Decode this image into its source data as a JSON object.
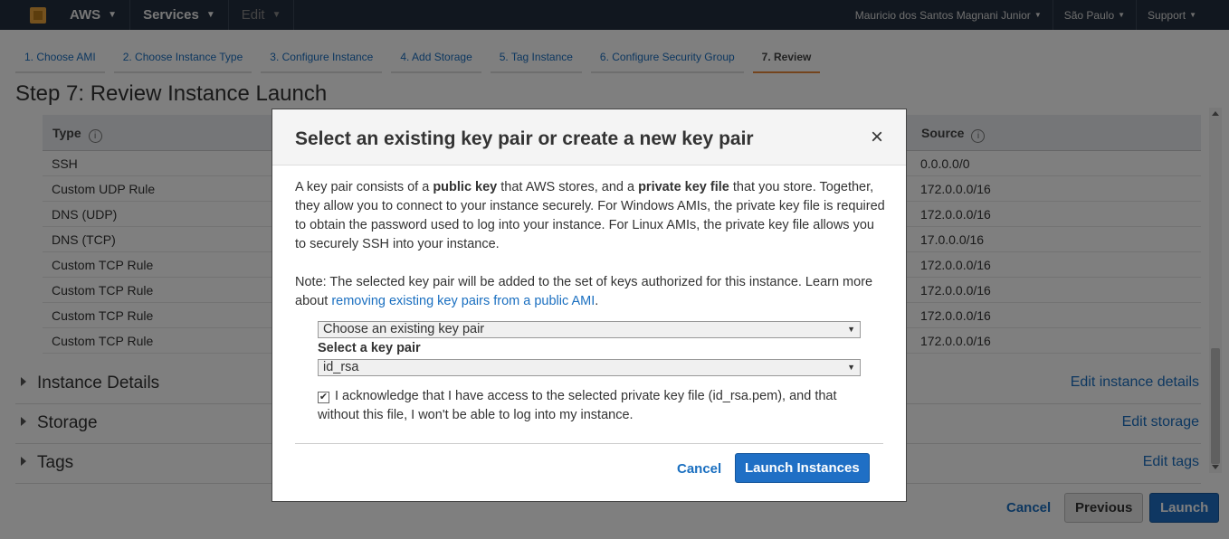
{
  "topnav": {
    "aws_label": "AWS",
    "services_label": "Services",
    "edit_label": "Edit",
    "user_label": "Mauricio dos Santos Magnani Junior",
    "region_label": "São Paulo",
    "support_label": "Support"
  },
  "wizard": {
    "tabs": [
      {
        "label": "1. Choose AMI"
      },
      {
        "label": "2. Choose Instance Type"
      },
      {
        "label": "3. Configure Instance"
      },
      {
        "label": "4. Add Storage"
      },
      {
        "label": "5. Tag Instance"
      },
      {
        "label": "6. Configure Security Group"
      },
      {
        "label": "7. Review"
      }
    ]
  },
  "page": {
    "title": "Step 7: Review Instance Launch"
  },
  "rules_table": {
    "header_type": "Type",
    "header_source": "Source",
    "rows": [
      {
        "type": "SSH",
        "source": "0.0.0.0/0"
      },
      {
        "type": "Custom UDP Rule",
        "source": "172.0.0.0/16"
      },
      {
        "type": "DNS (UDP)",
        "source": "172.0.0.0/16"
      },
      {
        "type": "DNS (TCP)",
        "source": "17.0.0.0/16"
      },
      {
        "type": "Custom TCP Rule",
        "source": "172.0.0.0/16"
      },
      {
        "type": "Custom TCP Rule",
        "source": "172.0.0.0/16"
      },
      {
        "type": "Custom TCP Rule",
        "source": "172.0.0.0/16"
      },
      {
        "type": "Custom TCP Rule",
        "source": "172.0.0.0/16"
      }
    ]
  },
  "sections": [
    {
      "title": "Instance Details",
      "edit": "Edit instance details"
    },
    {
      "title": "Storage",
      "edit": "Edit storage"
    },
    {
      "title": "Tags",
      "edit": "Edit tags"
    }
  ],
  "bottom": {
    "cancel": "Cancel",
    "previous": "Previous",
    "launch": "Launch"
  },
  "modal": {
    "title": "Select an existing key pair or create a new key pair",
    "close": "×",
    "p1_a": "A key pair consists of a ",
    "p1_b": "public key",
    "p1_c": " that AWS stores, and a ",
    "p1_d": "private key file",
    "p1_e": " that you store. Together, they allow you to connect to your instance securely. For Windows AMIs, the private key file is required to obtain the password used to log into your instance. For Linux AMIs, the private key file allows you to securely SSH into your instance.",
    "p2_a": "Note: The selected key pair will be added to the set of keys authorized for this instance. Learn more about ",
    "p2_link": "removing existing key pairs from a public AMI",
    "p2_b": ".",
    "keypair_mode": "Choose an existing key pair",
    "select_label": "Select a key pair",
    "selected_key": "id_rsa",
    "acknowledge_checked": true,
    "acknowledge_text": "I acknowledge that I have access to the selected private key file (id_rsa.pem), and that without this file, I won't be able to log into my instance.",
    "cancel": "Cancel",
    "launch": "Launch Instances"
  }
}
